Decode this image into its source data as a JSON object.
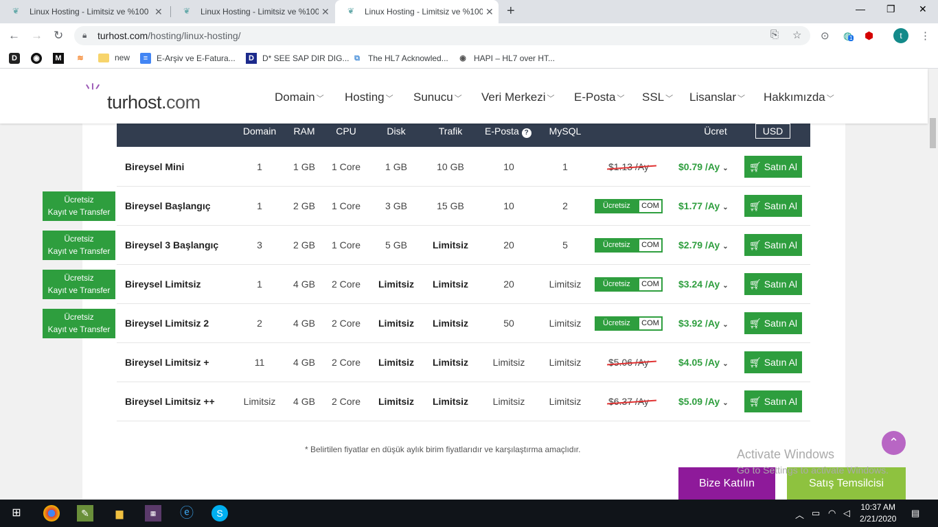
{
  "browser": {
    "tabs": [
      {
        "title": "Linux Hosting - Limitsiz ve %100"
      },
      {
        "title": "Linux Hosting - Limitsiz ve %100"
      },
      {
        "title": "Linux Hosting - Limitsiz ve %100"
      }
    ],
    "url_host": "turhost.com",
    "url_path": "/hosting/linux-hosting/",
    "profile_initial": "t",
    "ext_badge": "1"
  },
  "bookmarks": [
    {
      "label": "new"
    },
    {
      "label": "E-Arşiv ve E-Fatura..."
    },
    {
      "label": "D* SEE SAP DIR DIG..."
    },
    {
      "label": "The HL7 Acknowled..."
    },
    {
      "label": "HAPI – HL7 over HT..."
    }
  ],
  "site": {
    "logo_text": "turhost.",
    "logo_tld": "com",
    "menu": [
      "Domain",
      "Hosting",
      "Sunucu",
      "Veri Merkezi",
      "E-Posta",
      "SSL",
      "Lisanslar",
      "Hakkımızda"
    ]
  },
  "table": {
    "headers": {
      "domain": "Domain",
      "ram": "RAM",
      "cpu": "CPU",
      "disk": "Disk",
      "traffic": "Trafik",
      "email": "E-Posta",
      "mysql": "MySQL",
      "price": "Ücret",
      "currency": "USD"
    },
    "buy_label": "Satın Al",
    "promo_left": "Ücretsiz",
    "promo_right": "COM",
    "ribbon_line1": "Ücretsiz",
    "ribbon_line2": "Kayıt ve Transfer",
    "rows": [
      {
        "name": "Bireysel Mini",
        "domain": "1",
        "ram": "1 GB",
        "cpu": "1 Core",
        "disk": "1 GB",
        "traffic": "10 GB",
        "email": "10",
        "mysql": "1",
        "old": "$1.13 /Ay",
        "price": "$0.79 /Ay"
      },
      {
        "name": "Bireysel Başlangıç",
        "domain": "1",
        "ram": "2 GB",
        "cpu": "1 Core",
        "disk": "3 GB",
        "traffic": "15 GB",
        "email": "10",
        "mysql": "2",
        "price": "$1.77 /Ay"
      },
      {
        "name": "Bireysel 3 Başlangıç",
        "domain": "3",
        "ram": "2 GB",
        "cpu": "1 Core",
        "disk": "5 GB",
        "traffic": "Limitsiz",
        "email": "20",
        "mysql": "5",
        "price": "$2.79 /Ay"
      },
      {
        "name": "Bireysel Limitsiz",
        "domain": "1",
        "ram": "4 GB",
        "cpu": "2 Core",
        "disk": "Limitsiz",
        "traffic": "Limitsiz",
        "email": "20",
        "mysql": "Limitsiz",
        "price": "$3.24 /Ay"
      },
      {
        "name": "Bireysel Limitsiz 2",
        "domain": "2",
        "ram": "4 GB",
        "cpu": "2 Core",
        "disk": "Limitsiz",
        "traffic": "Limitsiz",
        "email": "50",
        "mysql": "Limitsiz",
        "price": "$3.92 /Ay"
      },
      {
        "name": "Bireysel Limitsiz +",
        "domain": "11",
        "ram": "4 GB",
        "cpu": "2 Core",
        "disk": "Limitsiz",
        "traffic": "Limitsiz",
        "email": "Limitsiz",
        "mysql": "Limitsiz",
        "old": "$5.06 /Ay",
        "price": "$4.05 /Ay"
      },
      {
        "name": "Bireysel Limitsiz ++",
        "domain": "Limitsiz",
        "ram": "4 GB",
        "cpu": "2 Core",
        "disk": "Limitsiz",
        "traffic": "Limitsiz",
        "email": "Limitsiz",
        "mysql": "Limitsiz",
        "old": "$6.37 /Ay",
        "price": "$5.09 /Ay"
      }
    ]
  },
  "note": "* Belirtilen fiyatlar en düşük aylık birim fiyatlarıdır ve karşılaştırma amaçlıdır.",
  "watermark": {
    "line1": "Activate Windows",
    "line2": "Go to Settings to activate Windows."
  },
  "cta": {
    "join": "Bize Katılın",
    "sales": "Satış Temsilcisi"
  },
  "taskbar": {
    "time": "10:37 AM",
    "date": "2/21/2020"
  },
  "colors": {
    "accent_green": "#2e9e3e",
    "header_dark": "#323d4f",
    "purple": "#8e1a9a",
    "lime": "#8ec23f"
  }
}
